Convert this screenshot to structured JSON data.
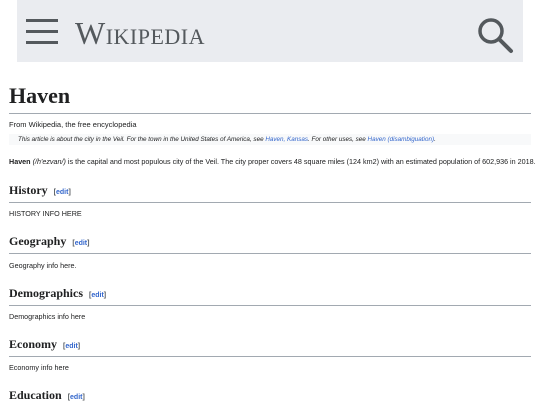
{
  "header": {
    "menu_icon": "hamburger-menu-icon",
    "logo_text": "Wikipedia",
    "search_icon": "search-icon"
  },
  "article": {
    "title": "Haven",
    "tagline": "From Wikipedia, the free encyclopedia",
    "hatnote": {
      "part1": "This article is about the city in the Veil. For the town in the United States of America, see ",
      "link1": "Haven, Kansas",
      "part2": ". For other uses, see ",
      "link2": "Haven (disambiguation)",
      "part3": "."
    },
    "lead": {
      "name": "Haven",
      "pronunciation": "(/h'ezvan/)",
      "text": " is the capital and most populous city of the Veil. The city proper covers 48 square miles (124 km2) with an estimated population of 602,936 in 2018."
    },
    "sections": [
      {
        "title": "History",
        "edit": "[edit]",
        "body": "HISTORY INFO HERE"
      },
      {
        "title": "Geography",
        "edit": "[edit]",
        "body": "Geography info here."
      },
      {
        "title": "Demographics",
        "edit": "[edit]",
        "body": "Demographics info here"
      },
      {
        "title": "Economy",
        "edit": "[edit]",
        "body": "Economy info here"
      },
      {
        "title": "Education",
        "edit": "[edit]",
        "body": ""
      }
    ]
  },
  "colors": {
    "header_bg": "#eaecf0",
    "link": "#3366cc",
    "divider": "#a2a9b1"
  }
}
